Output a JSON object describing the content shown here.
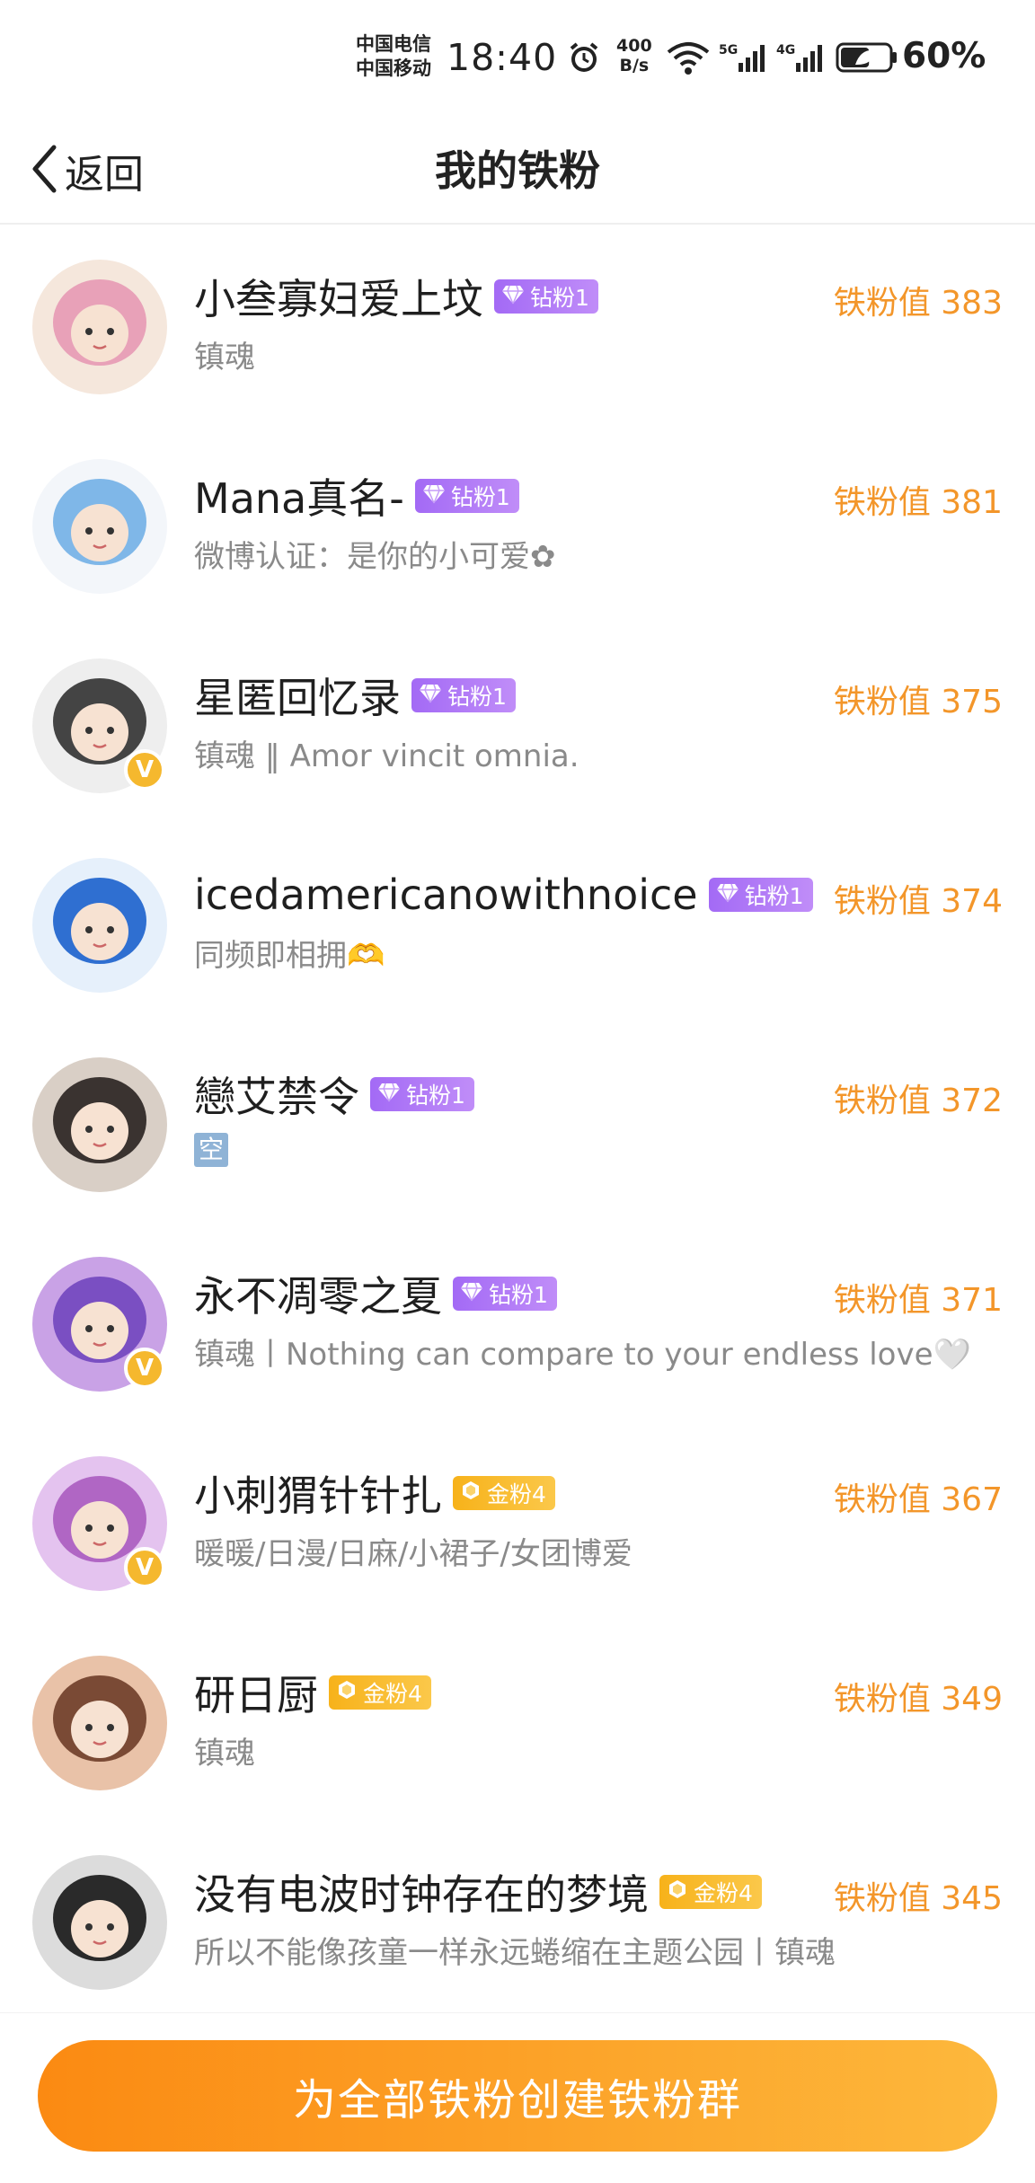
{
  "status_bar": {
    "carrier1": "中国电信",
    "carrier2": "中国移动",
    "time": "18:40",
    "speed_value": "400",
    "speed_unit": "B/s",
    "network1": "5G",
    "network2": "4G",
    "battery": "60%",
    "battery_level": 0.6,
    "icons": [
      "alarm-icon",
      "wifi-icon",
      "signal-5g-icon",
      "signal-4g-icon",
      "battery-saver-icon"
    ]
  },
  "nav": {
    "back_label": "返回",
    "title": "我的铁粉"
  },
  "fans": [
    {
      "name": "小叁寡妇爱上坟",
      "tag": "钻粉1",
      "tag_type": "diamond",
      "score": "铁粉值 383",
      "desc": "镇魂",
      "verified": false,
      "avatar_colors": [
        "#f5e7dc",
        "#e8a1b8",
        "#c98a5e"
      ]
    },
    {
      "name": "Mana真名-",
      "tag": "钻粉1",
      "tag_type": "diamond",
      "score": "铁粉值 381",
      "desc": "微博认证：是你的小可爱✿",
      "verified": false,
      "avatar_colors": [
        "#f3f6fa",
        "#7fb7e8",
        "#f2b8c8"
      ]
    },
    {
      "name": "星匿回忆录",
      "tag": "钻粉1",
      "tag_type": "diamond",
      "score": "铁粉值 375",
      "desc": "镇魂 ‖ Amor vincit omnia.",
      "verified": true,
      "avatar_colors": [
        "#eeeeee",
        "#444444",
        "#9a9a9a"
      ]
    },
    {
      "name": "icedamericanowithnoice",
      "tag": "钻粉1",
      "tag_type": "diamond",
      "score": "铁粉值 374",
      "desc": "同频即相拥🫶",
      "verified": false,
      "avatar_colors": [
        "#e6f0fb",
        "#2f6fd1",
        "#f0b35a"
      ]
    },
    {
      "name": "戀艾禁令",
      "tag": "钻粉1",
      "tag_type": "diamond",
      "score": "铁粉值 372",
      "desc": "空",
      "desc_style": "kong",
      "verified": false,
      "avatar_colors": [
        "#d9cfc6",
        "#3a3330",
        "#e2c7b0"
      ]
    },
    {
      "name": "永不凋零之夏",
      "tag": "钻粉1",
      "tag_type": "diamond",
      "score": "铁粉值 371",
      "desc": "镇魂丨Nothing can compare to your endless love🤍",
      "verified": true,
      "avatar_colors": [
        "#c9a2e6",
        "#7a4fc2",
        "#e9c6f2"
      ]
    },
    {
      "name": "小刺猬针针扎",
      "tag": "金粉4",
      "tag_type": "gold",
      "score": "铁粉值 367",
      "desc": "暖暖/日漫/日麻/小裙子/女团博爱",
      "verified": true,
      "avatar_colors": [
        "#e4c3ef",
        "#b066c4",
        "#f4a3c9"
      ]
    },
    {
      "name": "研日厨",
      "tag": "金粉4",
      "tag_type": "gold",
      "score": "铁粉值 349",
      "desc": "镇魂",
      "verified": false,
      "avatar_colors": [
        "#e9c2a8",
        "#7a4a35",
        "#f1d8c2"
      ]
    },
    {
      "name": "没有电波时钟存在的梦境",
      "tag": "金粉4",
      "tag_type": "gold",
      "score": "铁粉值 345",
      "desc": "所以不能像孩童一样永远蜷缩在主题公园丨镇魂",
      "verified": false,
      "avatar_colors": [
        "#dcdcdc",
        "#2a2a2a",
        "#8d8d8d"
      ]
    }
  ],
  "bottom": {
    "create_label": "为全部铁粉创建铁粉群"
  },
  "colors": {
    "accent_orange": "#f3962a",
    "diamond_tag": "#a36af5",
    "gold_tag": "#f7b21a",
    "verified_badge": "#f5b82e"
  }
}
